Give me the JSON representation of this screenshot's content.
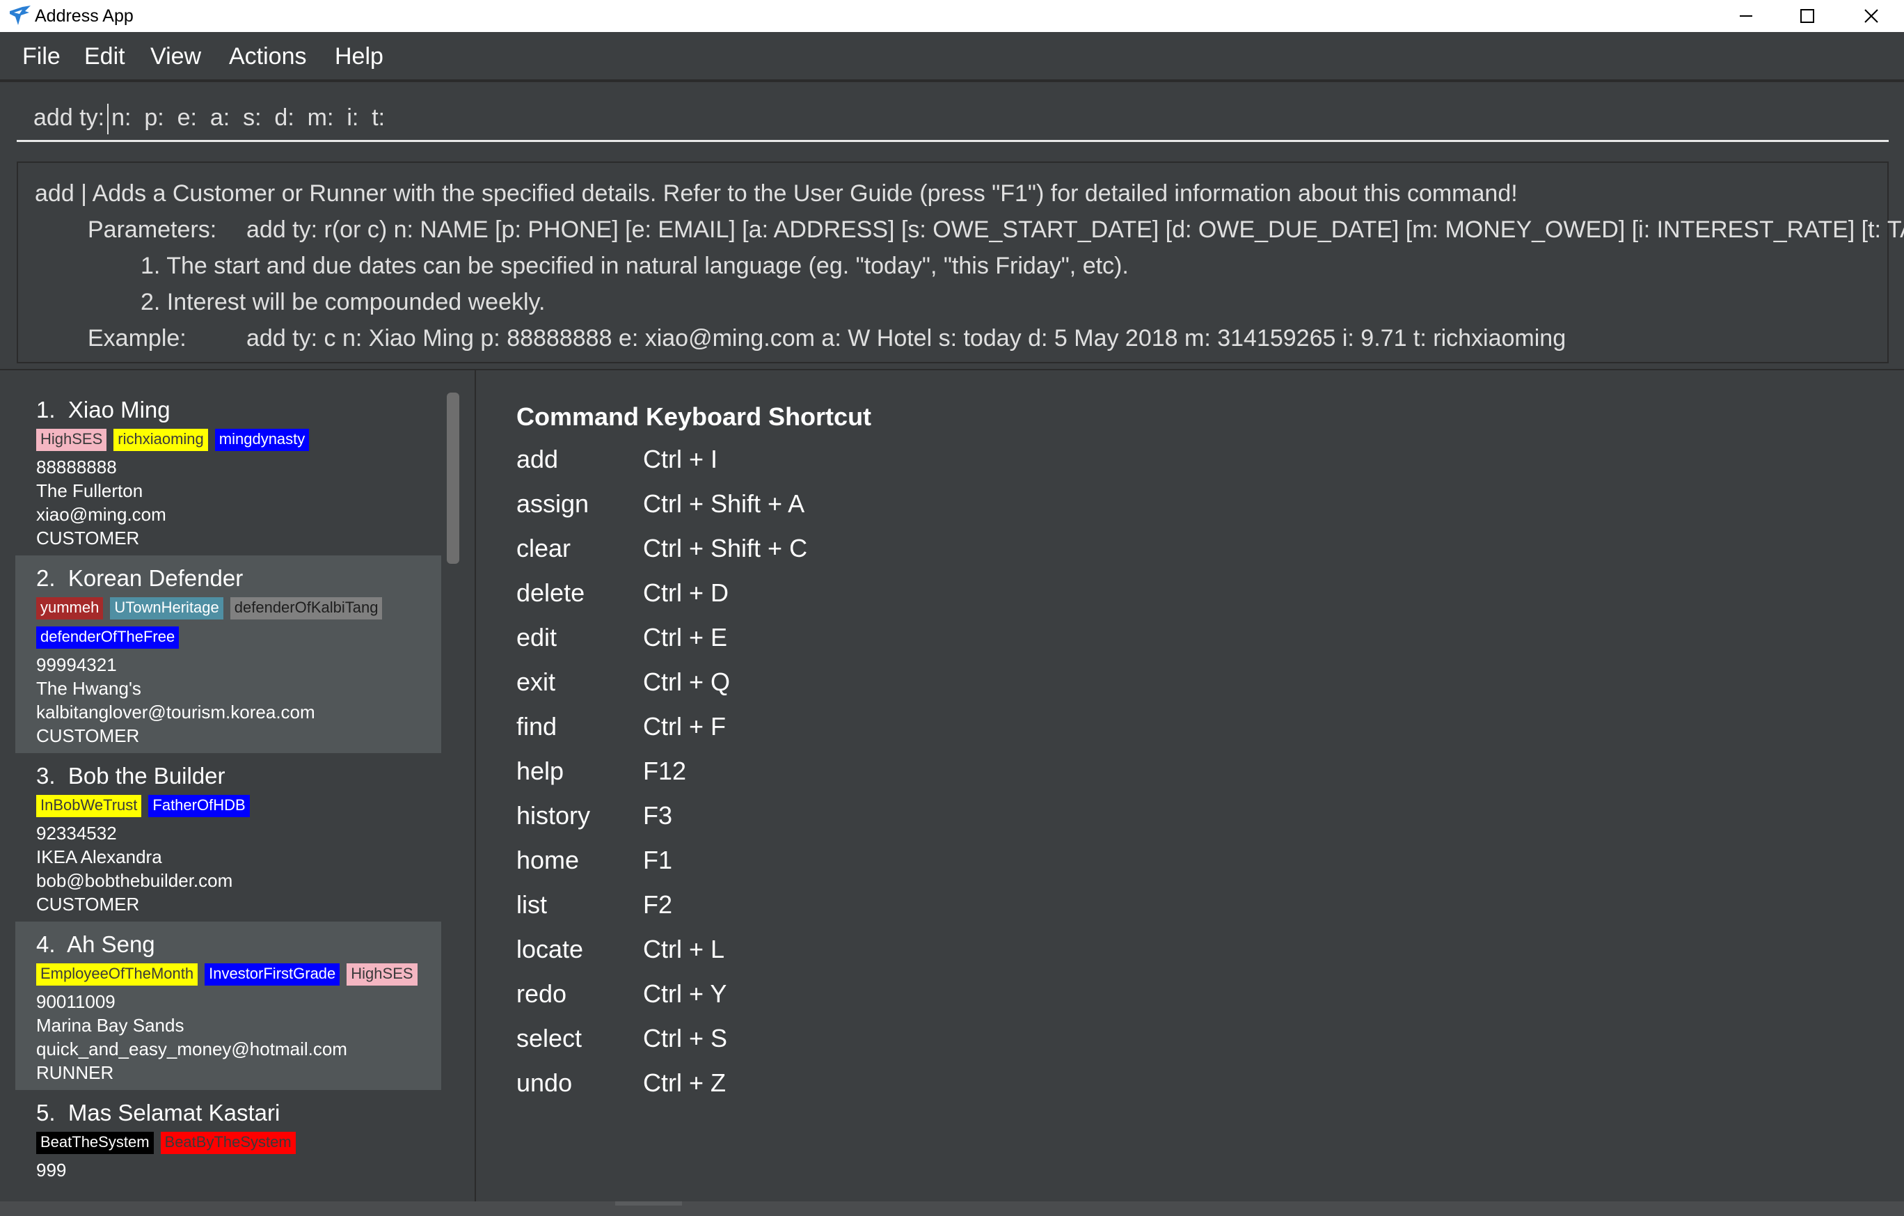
{
  "window": {
    "title": "Address App",
    "icon": "bird-logo-icon",
    "controls": [
      "minimize-icon",
      "maximize-icon",
      "close-icon"
    ]
  },
  "menu": {
    "items": [
      {
        "label": "File"
      },
      {
        "label": "Edit"
      },
      {
        "label": "View"
      },
      {
        "label": "Actions"
      },
      {
        "label": "Help"
      }
    ]
  },
  "command_box": {
    "value_before_caret": "add ty:",
    "value_after_caret": "n:  p:  e:  a:  s:  d:  m:  i:  t:"
  },
  "result": {
    "line1": "add | Adds a Customer or Runner with the specified details. Refer to the User Guide (press \"F1\") for detailed information about this command!",
    "params_label": "Parameters:",
    "params_value": "add ty: r(or c) n: NAME [p: PHONE] [e: EMAIL] [a: ADDRESS] [s: OWE_START_DATE] [d: OWE_DUE_DATE] [m: MONEY_OWED] [i: INTEREST_RATE] [t: TAG] ...",
    "note1": "1. The start and due dates can be specified in natural language (eg. \"today\", \"this Friday\", etc).",
    "note2": "2. Interest will be compounded weekly.",
    "example_label": "Example:",
    "example_value": "add ty: c n: Xiao Ming p: 88888888 e: xiao@ming.com a: W Hotel s: today d: 5 May 2018 m: 314159265 i: 9.71 t: richxiaoming"
  },
  "people": [
    {
      "index": "1.",
      "name": "Xiao Ming",
      "tags": [
        {
          "label": "HighSES",
          "color": "#f4b6c2",
          "text": "#3a3a3a"
        },
        {
          "label": "richxiaoming",
          "color": "#ffff00",
          "text": "#3a3a3a"
        },
        {
          "label": "mingdynasty",
          "color": "#0000ff",
          "text": "#ffffff"
        }
      ],
      "phone": "88888888",
      "address": "The Fullerton",
      "email": "xiao@ming.com",
      "type": "CUSTOMER"
    },
    {
      "index": "2.",
      "name": "Korean Defender",
      "tags": [
        {
          "label": "yummeh",
          "color": "#a52a2a",
          "text": "#ffffff"
        },
        {
          "label": "UTownHeritage",
          "color": "#4f8fa3",
          "text": "#ffffff"
        },
        {
          "label": "defenderOfKalbiTang",
          "color": "#808080",
          "text": "#1e1e1e"
        },
        {
          "label": "defenderOfTheFree",
          "color": "#0000ff",
          "text": "#ffffff"
        }
      ],
      "phone": "99994321",
      "address": "The Hwang's",
      "email": "kalbitanglover@tourism.korea.com",
      "type": "CUSTOMER"
    },
    {
      "index": "3.",
      "name": "Bob the Builder",
      "tags": [
        {
          "label": "InBobWeTrust",
          "color": "#ffff00",
          "text": "#3a3a3a"
        },
        {
          "label": "FatherOfHDB",
          "color": "#0000ff",
          "text": "#ffffff"
        }
      ],
      "phone": "92334532",
      "address": "IKEA Alexandra",
      "email": "bob@bobthebuilder.com",
      "type": "CUSTOMER"
    },
    {
      "index": "4.",
      "name": "Ah Seng",
      "tags": [
        {
          "label": "EmployeeOfTheMonth",
          "color": "#ffff00",
          "text": "#3a3a3a"
        },
        {
          "label": "InvestorFirstGrade",
          "color": "#0000ff",
          "text": "#ffffff"
        },
        {
          "label": "HighSES",
          "color": "#f4b6c2",
          "text": "#3a3a3a"
        }
      ],
      "phone": "90011009",
      "address": "Marina Bay Sands",
      "email": "quick_and_easy_money@hotmail.com",
      "type": "RUNNER"
    },
    {
      "index": "5.",
      "name": "Mas Selamat Kastari",
      "tags": [
        {
          "label": "BeatTheSystem",
          "color": "#000000",
          "text": "#ffffff"
        },
        {
          "label": "BeatByTheSystem",
          "color": "#ff0000",
          "text": "#3a3a3a"
        }
      ],
      "phone": "999",
      "address": "",
      "email": "",
      "type": ""
    }
  ],
  "shortcuts": {
    "header": "Command Keyboard Shortcut",
    "rows": [
      {
        "command": "add",
        "key": "Ctrl + I"
      },
      {
        "command": "assign",
        "key": "Ctrl + Shift + A"
      },
      {
        "command": "clear",
        "key": "Ctrl + Shift + C"
      },
      {
        "command": "delete",
        "key": "Ctrl + D"
      },
      {
        "command": "edit",
        "key": "Ctrl + E"
      },
      {
        "command": "exit",
        "key": "Ctrl + Q"
      },
      {
        "command": "find",
        "key": "Ctrl + F"
      },
      {
        "command": "help",
        "key": "F12"
      },
      {
        "command": "history",
        "key": "F3"
      },
      {
        "command": "home",
        "key": "F1"
      },
      {
        "command": "list",
        "key": "F2"
      },
      {
        "command": "locate",
        "key": "Ctrl + L"
      },
      {
        "command": "redo",
        "key": "Ctrl + Y"
      },
      {
        "command": "select",
        "key": "Ctrl + S"
      },
      {
        "command": "undo",
        "key": "Ctrl + Z"
      }
    ]
  }
}
